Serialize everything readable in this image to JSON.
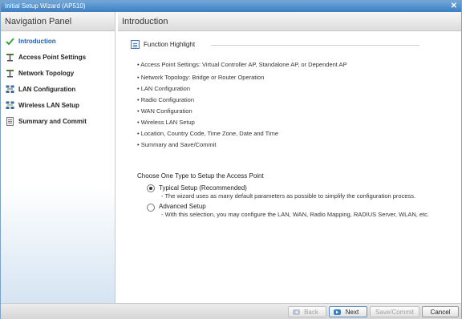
{
  "window": {
    "title": "Initial Setup Wizard (AP510)",
    "close_glyph": "✕"
  },
  "nav": {
    "header": "Navigation Panel",
    "items": [
      {
        "label": "Introduction",
        "icon": "check-icon",
        "active": true
      },
      {
        "label": "Access Point Settings",
        "icon": "antenna-icon"
      },
      {
        "label": "Network Topology",
        "icon": "antenna-icon"
      },
      {
        "label": "LAN Configuration",
        "icon": "network-icon"
      },
      {
        "label": "Wireless LAN Setup",
        "icon": "wireless-network-icon"
      },
      {
        "label": "Summary and Commit",
        "icon": "document-icon"
      }
    ]
  },
  "content": {
    "header": "Introduction",
    "function_highlight": "Function Highlight",
    "bullets": [
      "• Access Point Settings: Virtual Controller AP, Standalone AP, or Dependent AP",
      "• Network Topology: Bridge or Router Operation",
      "• LAN Configuration",
      "• Radio Configuration",
      "• WAN Configuration",
      "• Wireless LAN Setup",
      "• Location, Country Code, Time Zone, Date and Time",
      "• Summary and Save/Commit"
    ],
    "choose_label": "Choose One Type to Setup the Access Point",
    "options": [
      {
        "label": "Typical Setup (Recommended)",
        "desc": "- The wizard uses as many default parameters as possible to simplify the configuration process.",
        "selected": true
      },
      {
        "label": "Advanced Setup",
        "desc": "- With this selection, you may configure the LAN, WAN, Radio Mapping, RADIUS Server, WLAN, etc.",
        "selected": false
      }
    ]
  },
  "footer": {
    "back": "Back",
    "next": "Next",
    "save_commit": "Save/Commit",
    "cancel": "Cancel"
  },
  "colors": {
    "titlebar": "#3e7fc0",
    "accent": "#1f5fae",
    "check": "#3aa334"
  }
}
